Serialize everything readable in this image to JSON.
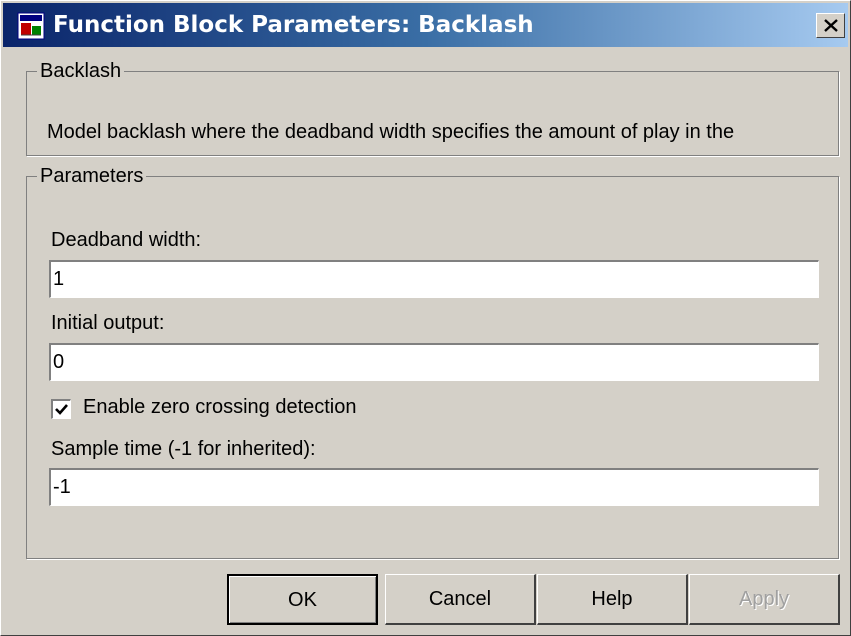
{
  "window": {
    "title": "Function Block Parameters: Backlash",
    "close_icon": "close-icon",
    "app_icon": "simulink-block-icon"
  },
  "description_group": {
    "legend": "Backlash",
    "text": "Model backlash where the deadband width specifies the amount of play in the"
  },
  "parameters_group": {
    "legend": "Parameters",
    "deadband_width": {
      "label": "Deadband width:",
      "value": "1"
    },
    "initial_output": {
      "label": "Initial output:",
      "value": "0"
    },
    "zero_crossing": {
      "label": "Enable zero crossing detection",
      "checked": true
    },
    "sample_time": {
      "label": "Sample time (-1 for inherited):",
      "value": "-1"
    }
  },
  "buttons": {
    "ok": "OK",
    "cancel": "Cancel",
    "help": "Help",
    "apply": "Apply"
  },
  "colors": {
    "dialog_bg": "#d4d0c8",
    "titlebar_start": "#0a246a",
    "titlebar_end": "#a6caf0"
  }
}
